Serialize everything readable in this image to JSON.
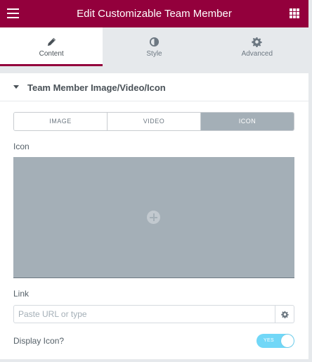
{
  "header": {
    "title": "Edit Customizable Team Member",
    "menu_icon": "hamburger-icon",
    "apps_icon": "grid-icon"
  },
  "tabs": [
    {
      "label": "Content",
      "icon": "pencil-icon",
      "active": true
    },
    {
      "label": "Style",
      "icon": "half-circle-icon",
      "active": false
    },
    {
      "label": "Advanced",
      "icon": "gear-icon",
      "active": false
    }
  ],
  "section": {
    "title": "Team Member Image/Video/Icon",
    "media_type": {
      "options": [
        "IMAGE",
        "VIDEO",
        "ICON"
      ],
      "selected": "ICON"
    },
    "icon_label": "Icon",
    "link_label": "Link",
    "link_placeholder": "Paste URL or type",
    "display_icon_label": "Display Icon?",
    "display_icon_toggle": "YES"
  },
  "colors": {
    "header_bg": "#93003c",
    "active_tab_border": "#93003c",
    "selected_option_bg": "#a4afb7",
    "toggle_on": "#71d7f7"
  }
}
